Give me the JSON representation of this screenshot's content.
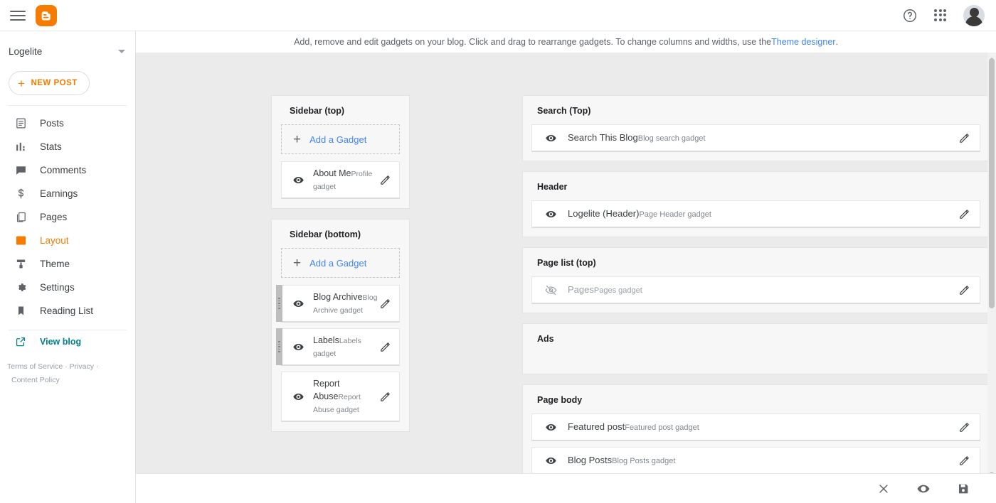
{
  "topbar": {
    "menu_icon": "hamburger-menu-icon",
    "logo_icon": "blogger-logo-icon",
    "logo_color": "#f57c00",
    "help_icon": "help-circle-icon",
    "apps_icon": "apps-grid-icon",
    "avatar_icon": "user-avatar"
  },
  "sidebar": {
    "blog_name": "Logelite",
    "new_post_label": "NEW POST",
    "new_post_plus": "+",
    "items": [
      {
        "label": "Posts",
        "icon": "posts-icon",
        "active": false
      },
      {
        "label": "Stats",
        "icon": "stats-icon",
        "active": false
      },
      {
        "label": "Comments",
        "icon": "comments-icon",
        "active": false
      },
      {
        "label": "Earnings",
        "icon": "earnings-icon",
        "active": false
      },
      {
        "label": "Pages",
        "icon": "pages-icon",
        "active": false
      },
      {
        "label": "Layout",
        "icon": "layout-icon",
        "active": true
      },
      {
        "label": "Theme",
        "icon": "theme-icon",
        "active": false
      },
      {
        "label": "Settings",
        "icon": "settings-gear-icon",
        "active": false
      },
      {
        "label": "Reading List",
        "icon": "reading-list-icon",
        "active": false
      }
    ],
    "view_blog_label": "View blog",
    "view_blog_icon": "external-link-icon",
    "view_blog_color": "#00818f",
    "active_color": "#f57c00",
    "legal": {
      "terms": "Terms of Service",
      "sep1": "·",
      "privacy": "Privacy",
      "sep2": "·",
      "content_policy": "Content Policy"
    }
  },
  "hint": {
    "text": "Add, remove and edit gadgets on your blog. Click and drag to rearrange gadgets. To change columns and widths, use the ",
    "link": "Theme designer",
    "period": "."
  },
  "layout": {
    "add_gadget_label": "Add a Gadget",
    "add_gadget_plus": "+",
    "edit_icon": "pencil-edit-icon",
    "visible_icon": "eye-visible-icon",
    "hidden_icon": "eye-hidden-icon",
    "drag_icon": "drag-handle-icon",
    "left_column": [
      {
        "title": "Sidebar (top)",
        "has_add_gadget": true,
        "gadgets": [
          {
            "name": "About Me",
            "type": "Profile gadget",
            "visible": true,
            "draggable": false
          }
        ]
      },
      {
        "title": "Sidebar (bottom)",
        "has_add_gadget": true,
        "gadgets": [
          {
            "name": "Blog Archive",
            "type": "Blog Archive gadget",
            "visible": true,
            "draggable": true
          },
          {
            "name": "Labels",
            "type": "Labels gadget",
            "visible": true,
            "draggable": true
          },
          {
            "name": "Report Abuse",
            "type": "Report Abuse gadget",
            "visible": true,
            "draggable": false
          }
        ]
      }
    ],
    "right_column": [
      {
        "title": "Search (Top)",
        "has_add_gadget": false,
        "gadgets": [
          {
            "name": "Search This Blog",
            "type": "Blog search gadget",
            "visible": true,
            "draggable": false
          }
        ]
      },
      {
        "title": "Header",
        "has_add_gadget": false,
        "gadgets": [
          {
            "name": "Logelite (Header)",
            "type": "Page Header gadget",
            "visible": true,
            "draggable": false
          }
        ]
      },
      {
        "title": "Page list (top)",
        "has_add_gadget": false,
        "gadgets": [
          {
            "name": "Pages",
            "type": "Pages gadget",
            "visible": false,
            "draggable": false
          }
        ]
      },
      {
        "title": "Ads",
        "has_add_gadget": false,
        "gadgets": []
      },
      {
        "title": "Page body",
        "has_add_gadget": false,
        "gadgets": [
          {
            "name": "Featured post",
            "type": "Featured post gadget",
            "visible": true,
            "draggable": false
          },
          {
            "name": "Blog Posts",
            "type": "Blog Posts gadget",
            "visible": true,
            "draggable": false
          }
        ]
      }
    ]
  },
  "bottombar": {
    "close_icon": "close-x-icon",
    "preview_icon": "eye-preview-icon",
    "save_icon": "save-disk-icon"
  },
  "scrollbar": {
    "up_icon": "scroll-up-arrow-icon",
    "down_icon": "scroll-down-arrow-icon"
  }
}
